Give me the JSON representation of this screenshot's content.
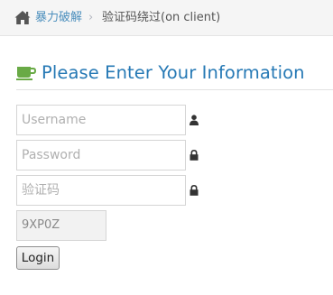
{
  "breadcrumb": {
    "home_icon": "home-icon",
    "link_label": "暴力破解",
    "separator": "›",
    "current_label": "验证码绕过(on client)"
  },
  "form": {
    "title": "Please Enter Your Information",
    "title_icon": "coffee-cup-icon",
    "username": {
      "placeholder": "Username",
      "value": "",
      "icon": "user-icon"
    },
    "password": {
      "placeholder": "Password",
      "value": "",
      "icon": "lock-icon"
    },
    "captcha": {
      "placeholder": "验证码",
      "value": "",
      "icon": "lock-icon"
    },
    "captcha_code": "9XP0Z",
    "submit_label": "Login"
  },
  "colors": {
    "link": "#4c8fbd",
    "title": "#2679b5",
    "cup": "#69aa46",
    "breadcrumb_bg": "#f5f5f5"
  }
}
